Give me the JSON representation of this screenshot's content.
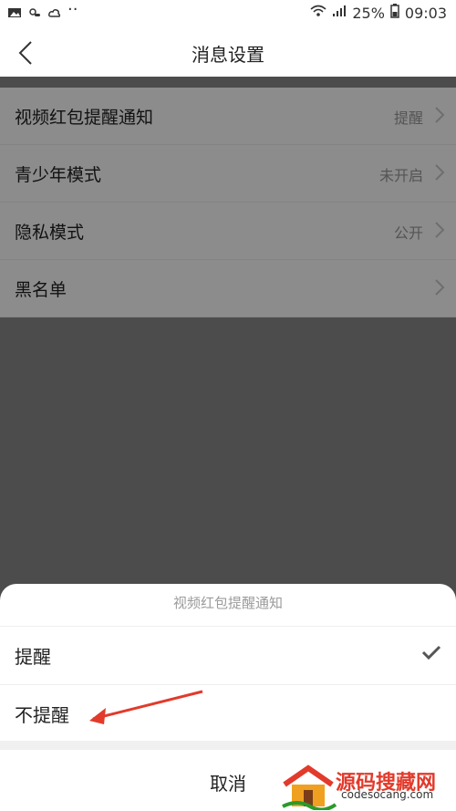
{
  "statusbar": {
    "battery_percent": "25%",
    "time": "09:03"
  },
  "header": {
    "title": "消息设置"
  },
  "settings": {
    "rows": [
      {
        "label": "视频红包提醒通知",
        "value": "提醒"
      },
      {
        "label": "青少年模式",
        "value": "未开启"
      },
      {
        "label": "隐私模式",
        "value": "公开"
      },
      {
        "label": "黑名单",
        "value": ""
      }
    ]
  },
  "sheet": {
    "title": "视频红包提醒通知",
    "options": [
      {
        "label": "提醒",
        "selected": true
      },
      {
        "label": "不提醒",
        "selected": false
      }
    ],
    "cancel_label": "取消"
  },
  "watermark": {
    "brand_text": "源码搜藏网",
    "site": "codesocang.com"
  },
  "colors": {
    "overlay": "#8a8a8a",
    "accent": "#e23a2b",
    "text": "#222222",
    "muted": "#9b9b9b"
  },
  "icons": {
    "back": "chevron-left-icon",
    "chevron": "chevron-right-icon",
    "check": "checkmark-icon"
  }
}
